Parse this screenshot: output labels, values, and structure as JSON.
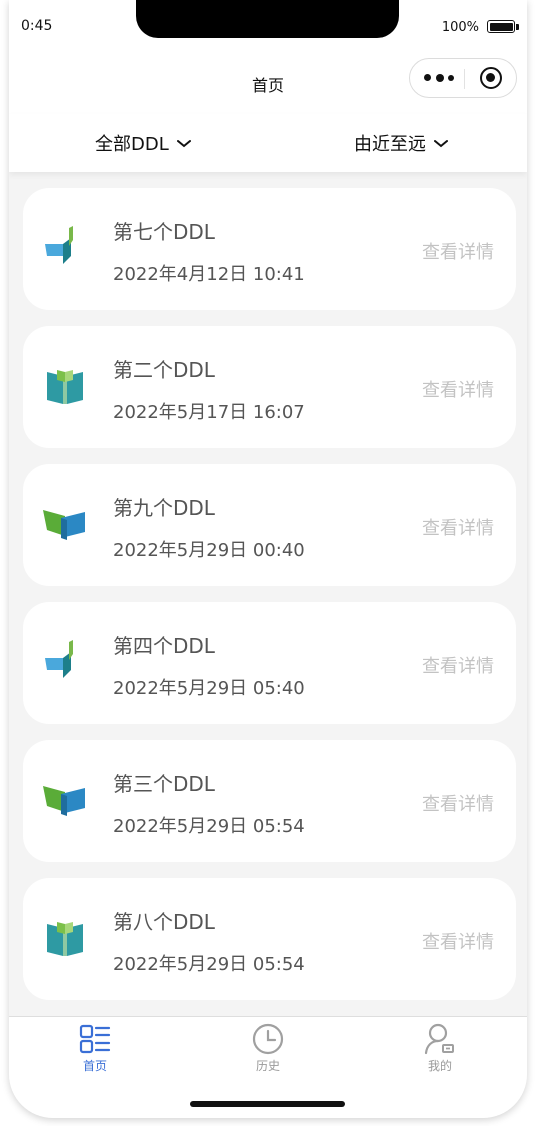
{
  "status_bar": {
    "time": "0:45",
    "battery": "100%"
  },
  "nav": {
    "title": "首页"
  },
  "filters": {
    "category": "全部DDL",
    "sort": "由近至远"
  },
  "cards": [
    {
      "title": "第七个DDL",
      "time": "2022年4月12日 10:41",
      "detail": "查看详情",
      "icon": "pen-book-icon"
    },
    {
      "title": "第二个DDL",
      "time": "2022年5月17日 16:07",
      "detail": "查看详情",
      "icon": "open-book-icon"
    },
    {
      "title": "第九个DDL",
      "time": "2022年5月29日 00:40",
      "detail": "查看详情",
      "icon": "flag-book-icon"
    },
    {
      "title": "第四个DDL",
      "time": "2022年5月29日 05:40",
      "detail": "查看详情",
      "icon": "pen-book-icon"
    },
    {
      "title": "第三个DDL",
      "time": "2022年5月29日 05:54",
      "detail": "查看详情",
      "icon": "flag-book-icon"
    },
    {
      "title": "第八个DDL",
      "time": "2022年5月29日 05:54",
      "detail": "查看详情",
      "icon": "open-book-icon"
    }
  ],
  "tabs": [
    {
      "label": "首页",
      "icon": "list-icon",
      "active": true
    },
    {
      "label": "历史",
      "icon": "clock-icon",
      "active": false
    },
    {
      "label": "我的",
      "icon": "user-icon",
      "active": false
    }
  ],
  "colors": {
    "accent": "#3a6fd6",
    "inactive": "#9a9a9a",
    "detail_text": "#c3c3c3"
  }
}
